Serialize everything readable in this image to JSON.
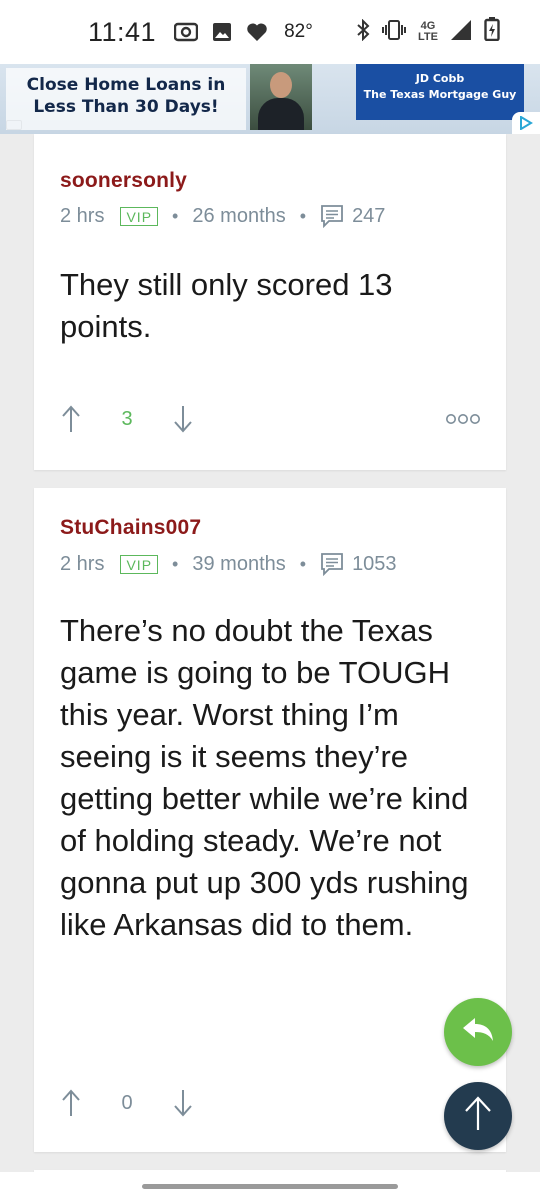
{
  "status_bar": {
    "time": "11:41",
    "temperature": "82°",
    "network_top": "4G",
    "network_bottom": "LTE",
    "icons": [
      "radio-icon",
      "gallery-icon",
      "heart-icon",
      "bluetooth-icon",
      "vibrate-icon",
      "signal-icon",
      "battery-icon"
    ]
  },
  "ad": {
    "headline_line1": "Close Home Loans in",
    "headline_line2": "Less Than 30 Days!",
    "advertiser": "JD Cobb",
    "tagline": "The Texas Mortgage Guy",
    "choices_icon": "adchoices-icon"
  },
  "posts": [
    {
      "username": "soonersonly",
      "time_ago": "2 hrs",
      "badge": "VIP",
      "tenure": "26 months",
      "post_count": "247",
      "body": "They still only scored 13 points.",
      "votes": "3"
    },
    {
      "username": "StuChains007",
      "time_ago": "2 hrs",
      "badge": "VIP",
      "tenure": "39 months",
      "post_count": "1053",
      "body": "There’s no doubt the Texas game is going to be TOUGH this year. Worst thing I’m seeing is it seems they’re getting better while we’re kind of holding steady. We’re not gonna put up 300 yds rushing like Arkansas did to them.",
      "votes": "0"
    }
  ],
  "colors": {
    "username": "#8c1a1a",
    "vip": "#5cb85c",
    "meta": "#7d8d99",
    "reply_fab": "#6cc04a",
    "top_fab": "#233b4f",
    "background": "#ececec"
  }
}
